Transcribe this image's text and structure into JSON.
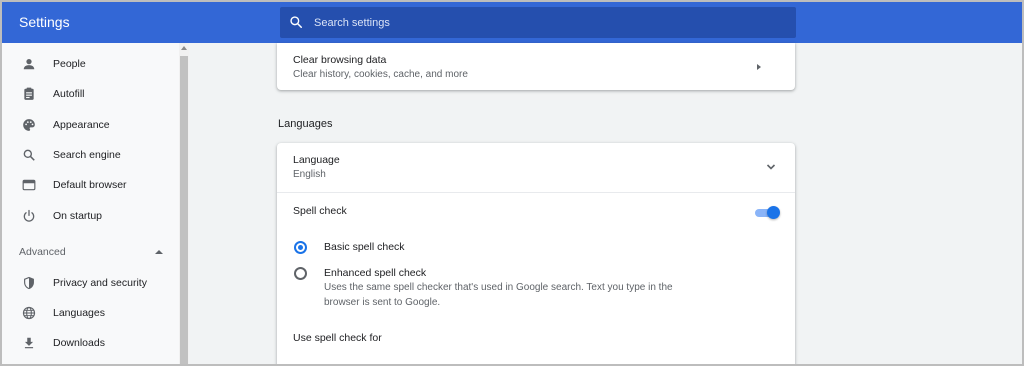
{
  "header": {
    "title": "Settings",
    "search_placeholder": "Search settings",
    "search_value": ""
  },
  "sidebar": {
    "items": [
      {
        "label": "People",
        "icon": "person-icon"
      },
      {
        "label": "Autofill",
        "icon": "clipboard-icon"
      },
      {
        "label": "Appearance",
        "icon": "palette-icon"
      },
      {
        "label": "Search engine",
        "icon": "search-icon"
      },
      {
        "label": "Default browser",
        "icon": "browser-icon"
      },
      {
        "label": "On startup",
        "icon": "power-icon"
      }
    ],
    "advanced_label": "Advanced",
    "advanced_items": [
      {
        "label": "Privacy and security",
        "icon": "shield-icon"
      },
      {
        "label": "Languages",
        "icon": "globe-icon"
      },
      {
        "label": "Downloads",
        "icon": "download-icon"
      }
    ]
  },
  "main": {
    "clear_browsing": {
      "title": "Clear browsing data",
      "subtitle": "Clear history, cookies, cache, and more"
    },
    "languages_section_title": "Languages",
    "language_row": {
      "title": "Language",
      "value": "English"
    },
    "spell_check": {
      "label": "Spell check",
      "enabled": true,
      "options": [
        {
          "label": "Basic spell check",
          "checked": true,
          "description": ""
        },
        {
          "label": "Enhanced spell check",
          "checked": false,
          "description_line1": "Uses the same spell checker that's used in Google search. Text you type in the",
          "description_line2": "browser is sent to Google."
        }
      ],
      "use_for_label": "Use spell check for"
    }
  },
  "colors": {
    "header_bg": "#3367d6",
    "search_bg": "#254fae",
    "accent": "#1a73e8",
    "sidebar_bg": "#f8f9fa",
    "page_bg": "#f1f3f4"
  }
}
